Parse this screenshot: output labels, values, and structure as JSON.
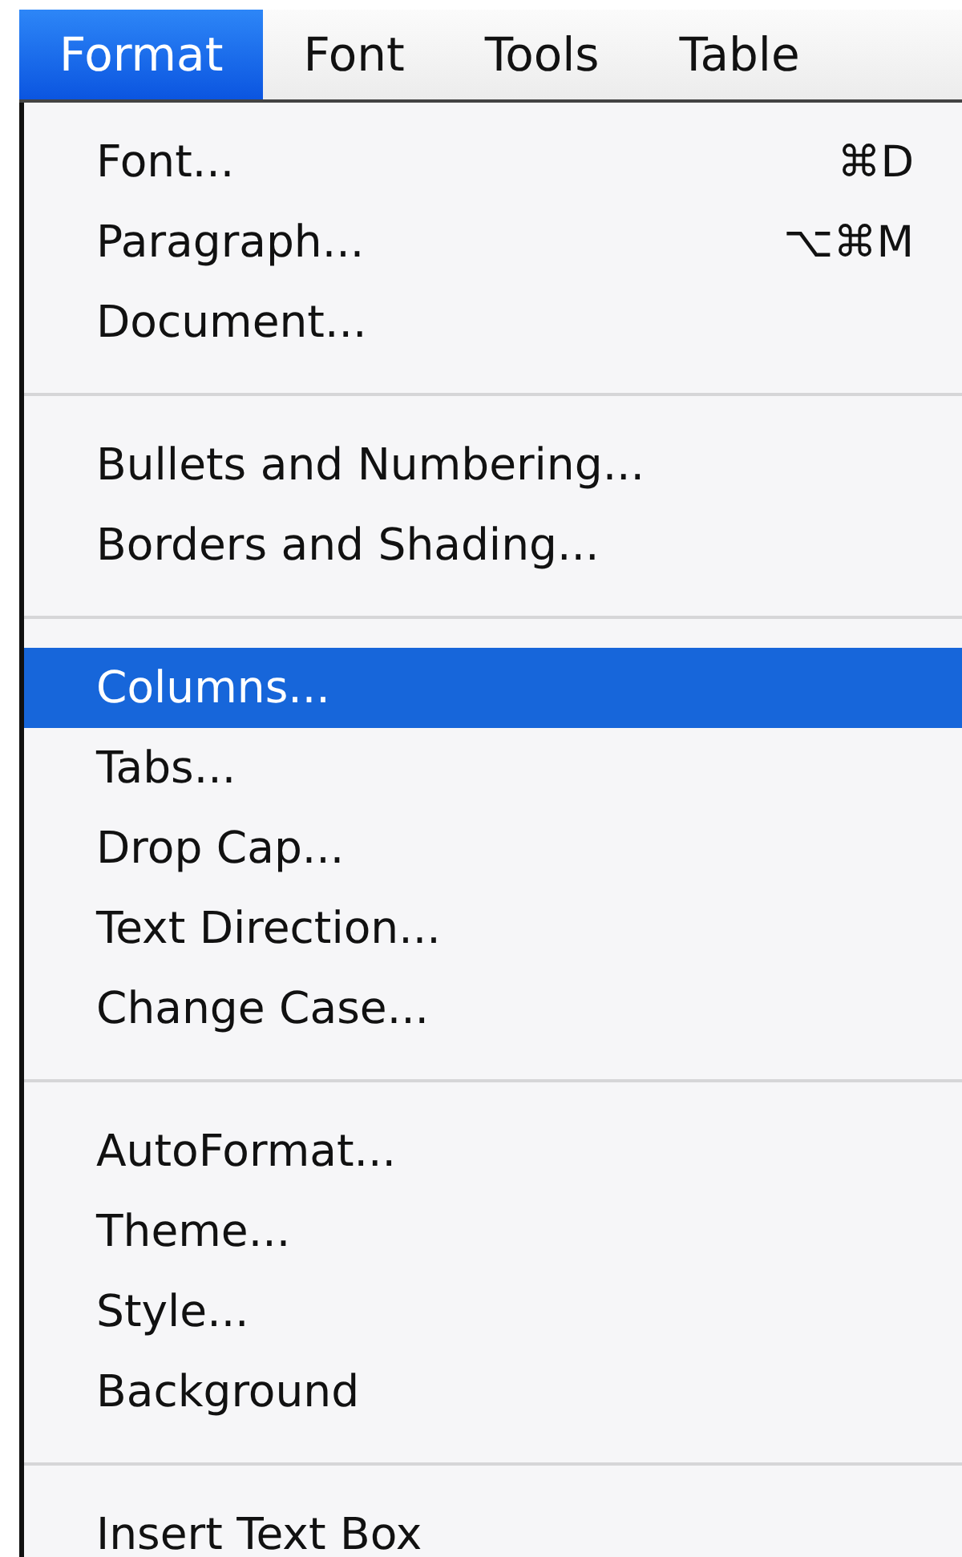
{
  "menubar": [
    {
      "label": "Format",
      "selected": true
    },
    {
      "label": "Font",
      "selected": false
    },
    {
      "label": "Tools",
      "selected": false
    },
    {
      "label": "Table",
      "selected": false
    }
  ],
  "menu": {
    "sections": [
      [
        {
          "label": "Font...",
          "shortcut": "⌘D",
          "selected": false
        },
        {
          "label": "Paragraph...",
          "shortcut": "⌥⌘M",
          "selected": false
        },
        {
          "label": "Document...",
          "selected": false
        }
      ],
      [
        {
          "label": "Bullets and Numbering...",
          "selected": false
        },
        {
          "label": "Borders and Shading...",
          "selected": false
        }
      ],
      [
        {
          "label": "Columns...",
          "selected": true
        },
        {
          "label": "Tabs...",
          "selected": false
        },
        {
          "label": "Drop Cap...",
          "selected": false
        },
        {
          "label": "Text Direction...",
          "selected": false
        },
        {
          "label": "Change Case...",
          "selected": false
        }
      ],
      [
        {
          "label": "AutoFormat...",
          "selected": false
        },
        {
          "label": "Theme...",
          "selected": false
        },
        {
          "label": "Style...",
          "selected": false
        },
        {
          "label": "Background",
          "selected": false
        }
      ],
      [
        {
          "label": "Insert Text Box",
          "selected": false
        }
      ]
    ]
  }
}
